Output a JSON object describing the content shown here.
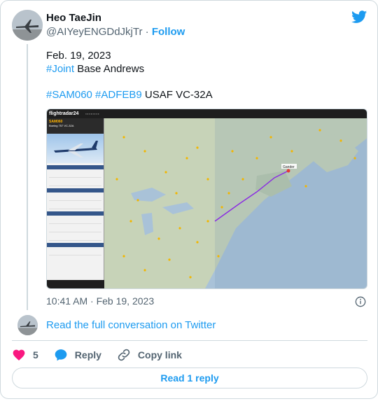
{
  "author": {
    "name": "Heo TaeJin",
    "handle": "@AIYeyENGDdJkjTr",
    "separator": "·",
    "follow_label": "Follow"
  },
  "tweet": {
    "line1": "Feb. 19, 2023",
    "line2_tag": "#Joint",
    "line2_rest": " Base Andrews",
    "line3_tag1": "#SAM060",
    "line3_tag2": "#ADFEB9",
    "line3_rest": " USAF VC-32A",
    "timestamp": "10:41 AM · Feb 19, 2023"
  },
  "map_screenshot": {
    "app_logo": "flightradar24",
    "callsign": "SAM060",
    "aircraft_type": "Boeing 757 VC-32A",
    "destination_label": "Gander"
  },
  "conversation_link": "Read the full conversation on Twitter",
  "actions": {
    "like_count": "5",
    "reply_label": "Reply",
    "copy_label": "Copy link"
  },
  "read_replies_label": "Read 1 reply",
  "colors": {
    "accent": "#1d9bf0",
    "like": "#f91880",
    "muted": "#536471",
    "border": "#cfd9de"
  }
}
